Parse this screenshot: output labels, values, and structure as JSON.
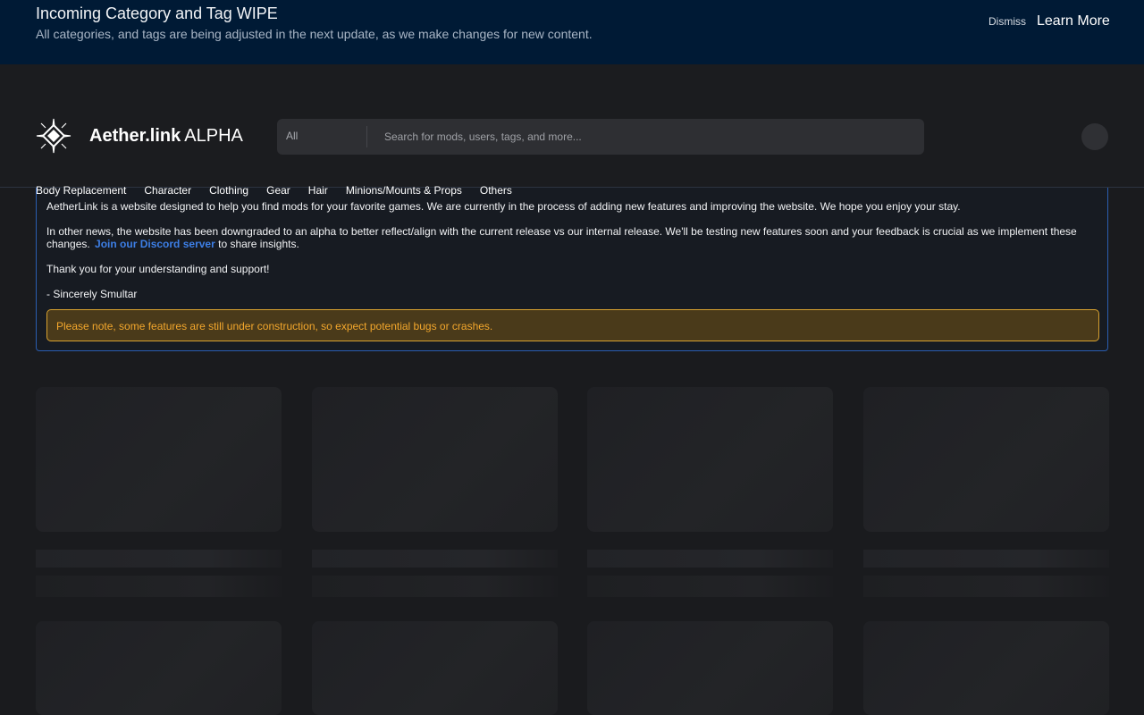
{
  "notice": {
    "title": "Incoming Category and Tag WIPE",
    "subtitle": "All categories, and tags are being adjusted in the next update, as we make changes for new content.",
    "dismiss_label": "Dismiss",
    "learn_more_label": "Learn More",
    "background": "#001a35"
  },
  "header": {
    "brand_name": "Aether.link",
    "brand_tag": "ALPHA",
    "logo_icon": "diamond-star-icon",
    "search": {
      "scope": "All",
      "placeholder": "Search for mods, users, tags, and more..."
    },
    "avatar_icon": "avatar-circle"
  },
  "categories": [
    "Body Replacement",
    "Character",
    "Clothing",
    "Gear",
    "Hair",
    "Minions/Mounts & Props",
    "Others"
  ],
  "announcement": {
    "p1": "AetherLink is a website designed to help you find mods for your favorite games. We are currently in the process of adding new features and improving the website. We hope you enjoy your stay.",
    "p2": "In other news, the website has been downgraded to an alpha to better reflect/align with the current release vs our internal release. We'll be testing new features soon and your feedback is crucial as we implement these changes.",
    "discord_link": "Join our Discord server",
    "p2_tail": "to share insights.",
    "p3": "Thank you for your understanding and support!",
    "p4": "- Sincerely Smultar",
    "warning": "Please note, some features are still under construction, so expect potential bugs or crashes.",
    "accent": "#2a5db0",
    "warning_color": "#f3a72c"
  }
}
